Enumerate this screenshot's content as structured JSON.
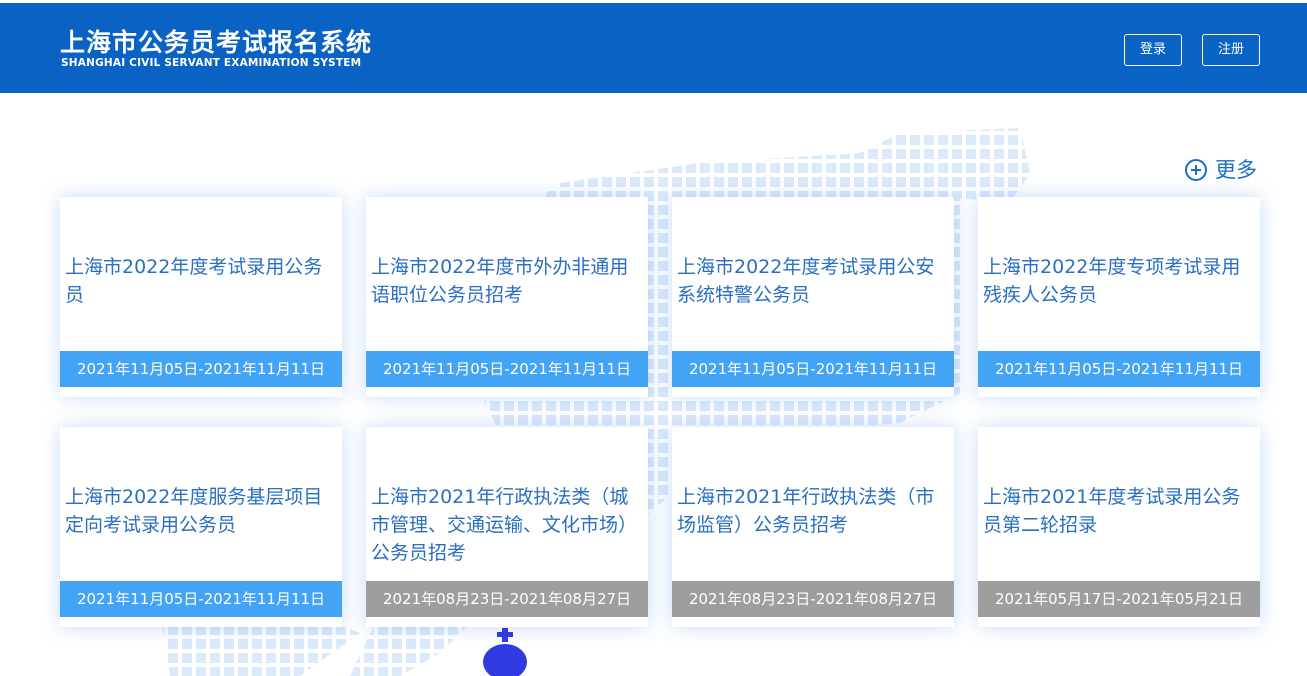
{
  "header": {
    "title": "上海市公务员考试报名系统",
    "subtitle": "SHANGHAI CIVIL SERVANT EXAMINATION SYSTEM",
    "login_label": "登录",
    "register_label": "注册"
  },
  "more": {
    "label": "更多",
    "icon": "plus-circle-icon"
  },
  "cards": [
    {
      "title": "上海市2022年度考试录用公务员",
      "date": "2021年11月05日-2021年11月11日",
      "status": "active"
    },
    {
      "title": "上海市2022年度市外办非通用语职位公务员招考",
      "date": "2021年11月05日-2021年11月11日",
      "status": "active"
    },
    {
      "title": "上海市2022年度考试录用公安系统特警公务员",
      "date": "2021年11月05日-2021年11月11日",
      "status": "active"
    },
    {
      "title": "上海市2022年度专项考试录用残疾人公务员",
      "date": "2021年11月05日-2021年11月11日",
      "status": "active"
    },
    {
      "title": "上海市2022年度服务基层项目定向考试录用公务员",
      "date": "2021年11月05日-2021年11月11日",
      "status": "active"
    },
    {
      "title": "上海市2021年行政执法类（城市管理、交通运输、文化市场）公务员招考",
      "date": "2021年08月23日-2021年08月27日",
      "status": "ended"
    },
    {
      "title": "上海市2021年行政执法类（市场监管）公务员招考",
      "date": "2021年08月23日-2021年08月27日",
      "status": "ended"
    },
    {
      "title": "上海市2021年度考试录用公务员第二轮招录",
      "date": "2021年05月17日-2021年05月21日",
      "status": "ended"
    }
  ],
  "colors": {
    "header_bg": "#0a63c4",
    "title_text": "#2a6fc0",
    "date_active": "#43a3f5",
    "date_ended": "#9e9e9e",
    "map_dots": "#dce9fb",
    "pin": "#2f3be0"
  }
}
